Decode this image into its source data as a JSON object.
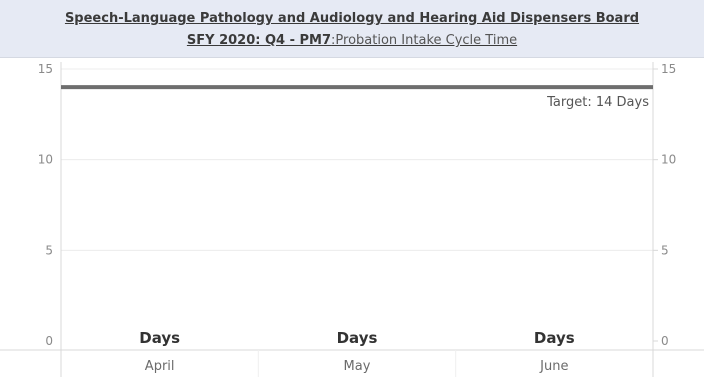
{
  "header": {
    "title": "Speech-Language Pathology and Audiology and Hearing Aid Dispensers Board",
    "subtitle_bold": "SFY 2020: Q4 -  PM7",
    "subtitle_rest": ":Probation Intake Cycle Time"
  },
  "chart_data": {
    "type": "bar",
    "categories": [
      "April",
      "May",
      "June"
    ],
    "series": [
      {
        "values": [
          null,
          null,
          null
        ],
        "data_labels": [
          "Days",
          "Days",
          "Days"
        ]
      }
    ],
    "target": {
      "value": 14,
      "label": "Target: 14 Days"
    },
    "ylim": [
      0,
      15
    ],
    "yticks": [
      0,
      5,
      10,
      15
    ],
    "y_axis_both_sides": true,
    "grid": true,
    "colors": {
      "target_line": "#6e6e6e",
      "grid": "#ececec",
      "axis": "#d8d8d8"
    }
  }
}
